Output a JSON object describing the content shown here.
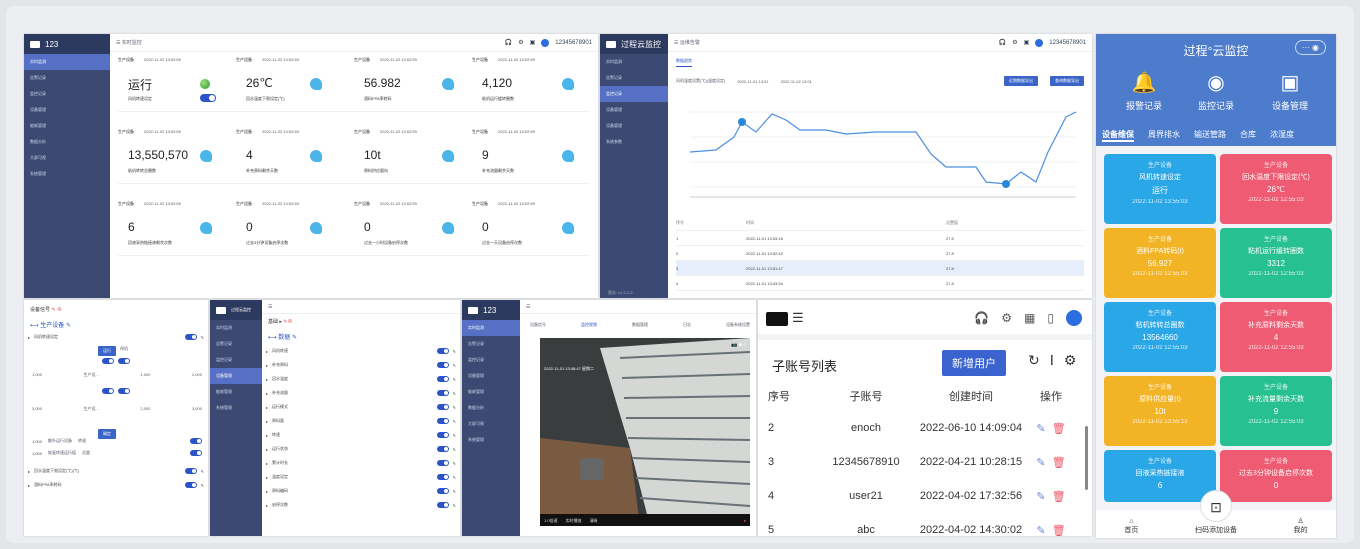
{
  "p1": {
    "logo": "123",
    "nav": [
      "实时监测",
      "告警记录",
      "监控记录",
      "设备管理",
      "能耗管理",
      "数据分析",
      "大屏可视",
      "系统管理"
    ],
    "breadcrumb": "实时监控",
    "user": "12345678901",
    "hdr": "生产设备",
    "ts": "2022-11-02 13:02:59",
    "rows": [
      [
        {
          "v": "运行",
          "l": "风机转速设定"
        },
        {
          "v": "26℃",
          "l": "回水温度下限设定(℃)"
        },
        {
          "v": "56.982",
          "l": "酒料FPA率转码"
        },
        {
          "v": "4,120",
          "l": "粘机运行缓转圈数"
        }
      ],
      [
        {
          "v": "13,550,570",
          "l": "粘机转转总圈数"
        },
        {
          "v": "4",
          "l": "补充原料剩余天数"
        },
        {
          "v": "10t",
          "l": "原料供应量向"
        },
        {
          "v": "9",
          "l": "补充流量剩余天数"
        }
      ],
      [
        {
          "v": "6",
          "l": "回液采热链接液剩余次数"
        },
        {
          "v": "0",
          "l": "过去3分钟设备启停次数"
        },
        {
          "v": "0",
          "l": "过去一小时设备启停次数"
        },
        {
          "v": "0",
          "l": "过去一天设备启停次数"
        }
      ]
    ]
  },
  "p2": {
    "logo": "过程云监控",
    "nav": [
      "实时监测",
      "告警记录",
      "监控记录",
      "设备管理",
      "设备管理",
      "系统参数"
    ],
    "breadcrumb": "运维告警",
    "tab": "数据趋势",
    "filter": "风机温度设置(℃)(温度设定)",
    "range_from": "2022-11-01 13:01",
    "range_to": "2022-11-02 13:01",
    "btn1": "近期数据导出",
    "btn2": "查询数据导出",
    "user": "12345678901",
    "cols": [
      "序号",
      "时间",
      "设置值"
    ],
    "rows": [
      [
        "1",
        "2022-11-01 13:53:18",
        "27.5"
      ],
      [
        "2",
        "2022-11-01 13:52:42",
        "27.8"
      ],
      [
        "3",
        "2022-11-01 13:51:47",
        "27.8"
      ],
      [
        "4",
        "2022-11-01 13:43:34",
        "27.8"
      ]
    ],
    "footer": "版本: v1.2.1.0"
  },
  "p3": {
    "title": "设备信号",
    "sub": "生产设备",
    "rows": [
      "风机转速设定",
      "回水温度下限设定(℃)(℃)",
      "酒料FPA率转码"
    ],
    "mid": [
      "1,000",
      "生产设...",
      "1,000",
      "2,000",
      "3,000",
      "生产设...",
      "2,000",
      "3,000"
    ],
    "bottom": [
      "1,000",
      "额外运行设备",
      "转速",
      "1,000",
      "恢复转速运行值",
      "总量"
    ]
  },
  "p4": {
    "logo": "过程云监控",
    "title": "基础 ▸",
    "sub": "数据",
    "items": [
      "风机转速",
      "补充原料",
      "回水温度",
      "补充流量",
      "运行模式",
      "原料量",
      "转速",
      "运行状态",
      "累计时长",
      "温度设定",
      "原料编码",
      "启停次数"
    ]
  },
  "p5": {
    "logo": "123",
    "tabs": [
      "设备信号",
      "监控视频",
      "数据管理",
      "日志",
      "设备系统设置"
    ],
    "ts": "2022-11-01 13:08:47 星期二",
    "bar": [
      "1.0倍速",
      "实时播放",
      "清晰"
    ]
  },
  "p6": {
    "title": "子账号列表",
    "add": "新增用户",
    "cols": [
      "序号",
      "子账号",
      "创建时间",
      "操作"
    ],
    "rows": [
      [
        "2",
        "enoch",
        "2022-06-10 14:09:04"
      ],
      [
        "3",
        "12345678910",
        "2022-04-21 10:28:15"
      ],
      [
        "4",
        "user21",
        "2022-04-02 17:32:56"
      ],
      [
        "5",
        "abc",
        "2022-04-02 14:30:02"
      ]
    ]
  },
  "mobile": {
    "title": "过程°云监控",
    "top": [
      "报警记录",
      "监控记录",
      "设备管理"
    ],
    "tabs": [
      "设备维保",
      "周界排水",
      "输送管路",
      "合库",
      "浓湿度"
    ],
    "cards": [
      {
        "t": "生产设备",
        "n": "风机转速设定",
        "v": "运行",
        "d": "2022-11-02 13:55:03",
        "c": "#2aa7e6"
      },
      {
        "t": "生产设备",
        "n": "回水温度下限设定(℃)",
        "v": "26℃",
        "d": "2022-11-02 12:55:03",
        "c": "#ee5b72"
      },
      {
        "t": "生产设备",
        "n": "酒料FPA转码(t)",
        "v": "56.927",
        "d": "2022-11-02 12:55:03",
        "c": "#f2b324"
      },
      {
        "t": "生产设备",
        "n": "粘机运行缓转圈数",
        "v": "3312",
        "d": "2022-11-02 12:55:03",
        "c": "#27c08f"
      },
      {
        "t": "生产设备",
        "n": "粘机转转总圈数",
        "v": "13564660",
        "d": "2022-11-02 12:55:03",
        "c": "#2aa7e6"
      },
      {
        "t": "生产设备",
        "n": "补充原料剩余天数",
        "v": "4",
        "d": "2022-11-02 12:55:03",
        "c": "#ee5b72"
      },
      {
        "t": "生产设备",
        "n": "原料供应量(t)",
        "v": "10t",
        "d": "2022-11-02 13:55:12",
        "c": "#f2b324"
      },
      {
        "t": "生产设备",
        "n": "补充流量剩余天数",
        "v": "9",
        "d": "2022-11-02 12:55:03",
        "c": "#27c08f"
      },
      {
        "t": "生产设备",
        "n": "回液采热链接液",
        "v": "6",
        "d": "",
        "c": "#2aa7e6"
      },
      {
        "t": "生产设备",
        "n": "过去3分钟设备启停次数",
        "v": "0",
        "d": "",
        "c": "#ee5b72"
      }
    ],
    "bottom": [
      "首页",
      "扫码添加设备",
      "我的"
    ]
  }
}
